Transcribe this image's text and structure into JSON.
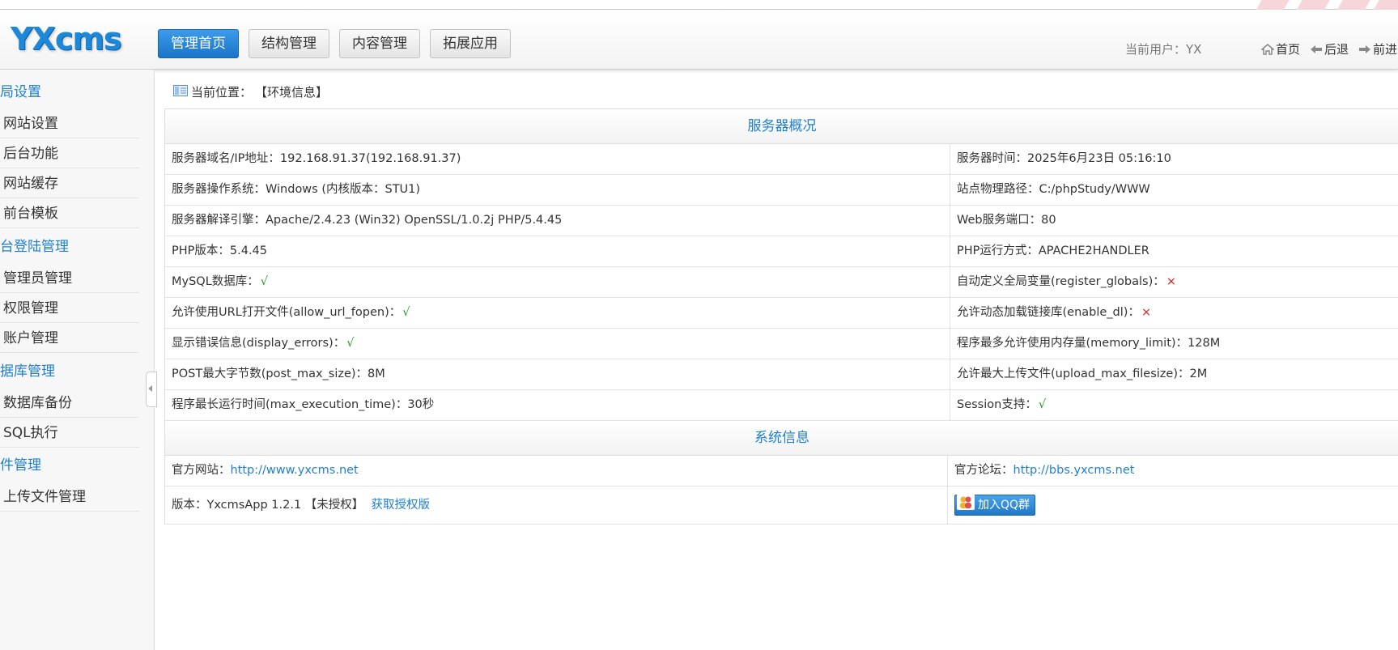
{
  "header": {
    "logo": "YXcms",
    "nav": [
      "管理首页",
      "结构管理",
      "内容管理",
      "拓展应用"
    ],
    "user_label": "当前用户：YX",
    "links": {
      "home": "首页",
      "back": "后退",
      "forward": "前进"
    }
  },
  "sidebar": {
    "sections": [
      {
        "title": "局设置",
        "items": [
          "网站设置",
          "后台功能",
          "网站缓存",
          "前台模板"
        ]
      },
      {
        "title": "台登陆管理",
        "items": [
          "管理员管理",
          "权限管理",
          "账户管理"
        ]
      },
      {
        "title": "据库管理",
        "items": [
          "数据库备份",
          "SQL执行"
        ]
      },
      {
        "title": "件管理",
        "items": [
          "上传文件管理"
        ]
      }
    ]
  },
  "breadcrumb": {
    "label": "当前位置：",
    "value": "【环境信息】"
  },
  "server": {
    "title": "服务器概况",
    "rows": [
      {
        "l": "服务器域名/IP地址：192.168.91.37(192.168.91.37)",
        "r": "服务器时间：2025年6月23日 05:16:10"
      },
      {
        "l": "服务器操作系统：Windows (内核版本：STU1)",
        "r": "站点物理路径：C:/phpStudy/WWW"
      },
      {
        "l": "服务器解译引擎：Apache/2.4.23 (Win32) OpenSSL/1.0.2j PHP/5.4.45",
        "r": "Web服务端口：80"
      },
      {
        "l": "PHP版本：5.4.45",
        "r": "PHP运行方式：APACHE2HANDLER"
      },
      {
        "l": "MySQL数据库：",
        "l_mark": "√",
        "r": "自动定义全局变量(register_globals)：",
        "r_mark": "×"
      },
      {
        "l": "允许使用URL打开文件(allow_url_fopen)：",
        "l_mark": "√",
        "r": "允许动态加载链接库(enable_dl)：",
        "r_mark": "×"
      },
      {
        "l": "显示错误信息(display_errors)：",
        "l_mark": "√",
        "r": "程序最多允许使用内存量(memory_limit)：128M"
      },
      {
        "l": "POST最大字节数(post_max_size)：8M",
        "r": "允许最大上传文件(upload_max_filesize)：2M"
      },
      {
        "l": "程序最长运行时间(max_execution_time)：30秒",
        "r": "Session支持：",
        "r_mark": "√"
      }
    ]
  },
  "system": {
    "title": "系统信息",
    "site_label": "官方网站：",
    "site_url": "http://www.yxcms.net",
    "forum_label": "官方论坛：",
    "forum_url": "http://bbs.yxcms.net",
    "version_label": "版本：YxcmsApp 1.2.1 【未授权】",
    "auth_link": "获取授权版",
    "qq_button": "加入QQ群"
  },
  "colors": {
    "accent": "#1f7fd0",
    "ok": "#2aa02a",
    "error": "#e02020"
  }
}
